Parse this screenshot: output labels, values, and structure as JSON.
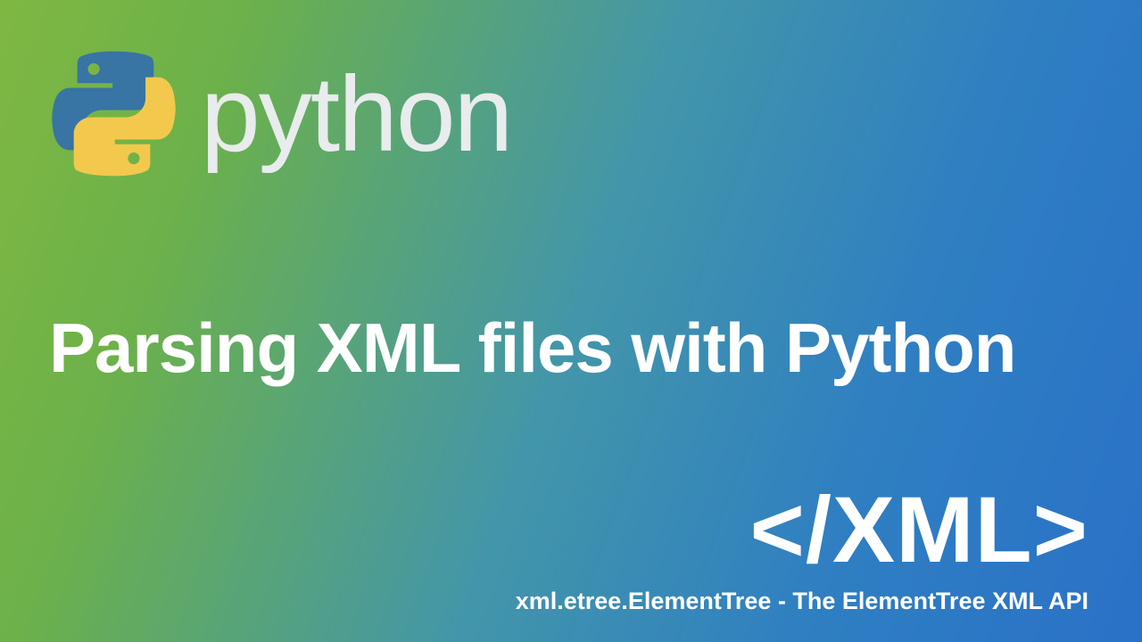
{
  "logo": {
    "word": "python"
  },
  "title": "Parsing XML files with Python",
  "xml_tag": "</XML>",
  "subtitle": "xml.etree.ElementTree - The ElementTree XML API",
  "colors": {
    "snake_blue": "#3874a4",
    "snake_yellow": "#f2c94c",
    "text_white": "#ffffff"
  }
}
